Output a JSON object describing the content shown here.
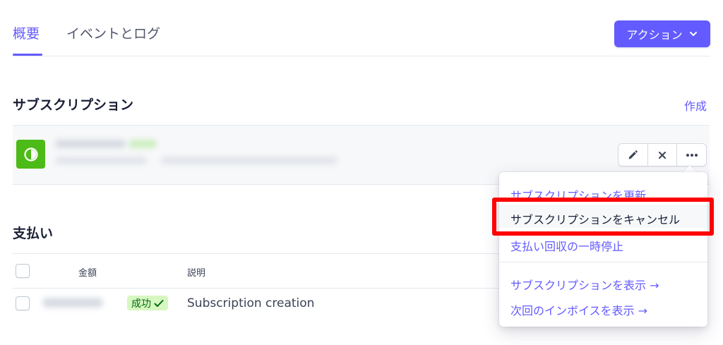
{
  "tabs": [
    {
      "label": "概要"
    },
    {
      "label": "イベントとログ"
    }
  ],
  "header": {
    "action_button_label": "アクション"
  },
  "subscription": {
    "title": "サブスクリプション",
    "create_link": "作成"
  },
  "menu": {
    "items": [
      {
        "label": "サブスクリプションを更新"
      },
      {
        "label": "サブスクリプションをキャンセル"
      },
      {
        "label": "支払い回収の一時停止"
      },
      {
        "label": "サブスクリプションを表示 →"
      },
      {
        "label": "次回のインボイスを表示 →"
      }
    ]
  },
  "payments": {
    "title": "支払い",
    "columns": [
      "金額",
      "説明"
    ],
    "rows": [
      {
        "status": "成功",
        "description": "Subscription creation"
      }
    ]
  },
  "colors": {
    "accent": "#635bff",
    "plan_icon": "#4cbb17",
    "success_bg": "#d7f7c2",
    "highlight": "#ff0000"
  }
}
